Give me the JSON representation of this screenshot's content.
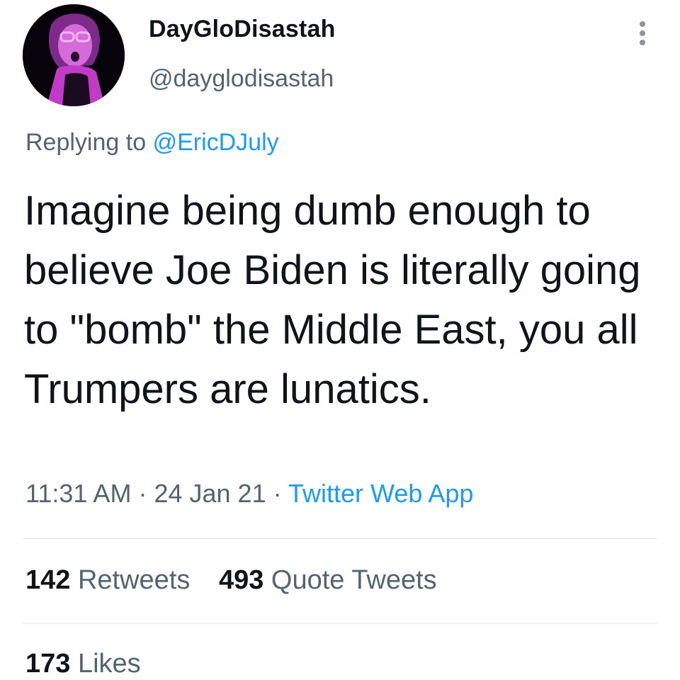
{
  "author": {
    "display_name": "DayGloDisastah",
    "handle": "@dayglodisastah",
    "avatar_icon": "profile-photo"
  },
  "menu": {
    "icon": "more-vertical-icon"
  },
  "reply": {
    "prefix": "Replying to",
    "mention": "@EricDJuly"
  },
  "tweet": {
    "text": "Imagine being dumb enough to believe Joe Biden is literally going to \"bomb\" the Middle East, you all Trumpers are lunatics.",
    "time": "11:31 AM",
    "separator": "·",
    "date": "24 Jan 21",
    "source": "Twitter Web App"
  },
  "stats": {
    "retweets_count": "142",
    "retweets_label": "Retweets",
    "quotes_count": "493",
    "quotes_label": "Quote Tweets",
    "likes_count": "173",
    "likes_label": "Likes"
  },
  "colors": {
    "text_primary": "#0f1419",
    "text_secondary": "#536471",
    "link": "#1d9bf0",
    "avatar_accent": "#e040e0"
  }
}
